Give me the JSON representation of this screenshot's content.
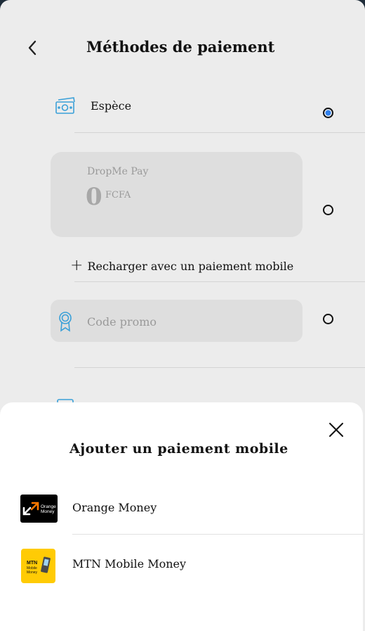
{
  "header": {
    "title": "Méthodes de paiement"
  },
  "payment_methods": {
    "cash": {
      "label": "Espèce",
      "selected": true
    },
    "wallet": {
      "name": "DropMe Pay",
      "balance": "0",
      "currency": "FCFA",
      "selected": false
    },
    "recharge": {
      "label": "Recharger avec un paiement mobile"
    },
    "promo": {
      "label": "Code promo",
      "selected": false
    }
  },
  "sheet": {
    "title": "Ajouter un paiement mobile",
    "providers": [
      {
        "label": "Orange Money",
        "logo_text": [
          "Orange",
          "Money"
        ]
      },
      {
        "label": "MTN Mobile Money",
        "logo_text": [
          "MTN",
          "Mobile",
          "Money"
        ]
      }
    ]
  },
  "colors": {
    "accent_blue": "#2f80ed",
    "icon_blue": "#3aa0d8",
    "orange": "#ff7900",
    "mtn_yellow": "#ffcb05"
  }
}
